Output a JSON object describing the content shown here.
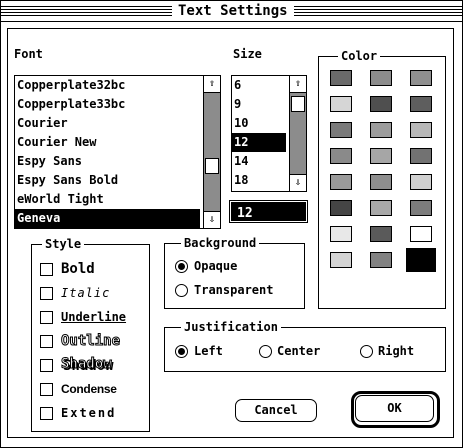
{
  "window": {
    "title": "Text Settings"
  },
  "font": {
    "label": "Font",
    "items": [
      {
        "label": "Copperplate32bc"
      },
      {
        "label": "Copperplate33bc"
      },
      {
        "label": "Courier"
      },
      {
        "label": "Courier New"
      },
      {
        "label": "Espy Sans"
      },
      {
        "label": "Espy Sans Bold"
      },
      {
        "label": "eWorld Tight"
      },
      {
        "label": "Geneva"
      }
    ],
    "selected": "Geneva"
  },
  "size": {
    "label": "Size",
    "items": [
      {
        "label": "6"
      },
      {
        "label": "9"
      },
      {
        "label": "10"
      },
      {
        "label": "12"
      },
      {
        "label": "14"
      },
      {
        "label": "18"
      }
    ],
    "selected": "12",
    "field_value": "12"
  },
  "color": {
    "label": "Color",
    "swatches": [
      "#6a6a6a",
      "#8c8c8c",
      "#8f8f8f",
      "#d6d6d6",
      "#4f4f4f",
      "#5e5e5e",
      "#7a7a7a",
      "#9c9c9c",
      "#b8b8b8",
      "#8a8a8a",
      "#a6a6a6",
      "#727272",
      "#9a9a9a",
      "#8e8e8e",
      "#d0d0d0",
      "#454545",
      "#a8a8a8",
      "#7c7c7c",
      "#e8e8e8",
      "#5a5a5a",
      "#ffffff",
      "#d4d4d4",
      "#828282",
      "#000000"
    ],
    "selected_index": 23
  },
  "style": {
    "label": "Style",
    "options": [
      {
        "label": "Bold",
        "checked": false
      },
      {
        "label": "Italic",
        "checked": false
      },
      {
        "label": "Underline",
        "checked": false
      },
      {
        "label": "Outline",
        "checked": false
      },
      {
        "label": "Shadow",
        "checked": false
      },
      {
        "label": "Condense",
        "checked": false
      },
      {
        "label": "Extend",
        "checked": false
      }
    ]
  },
  "background": {
    "label": "Background",
    "options": [
      {
        "label": "Opaque",
        "selected": true
      },
      {
        "label": "Transparent",
        "selected": false
      }
    ]
  },
  "justification": {
    "label": "Justification",
    "options": [
      {
        "label": "Left",
        "selected": true
      },
      {
        "label": "Center",
        "selected": false
      },
      {
        "label": "Right",
        "selected": false
      }
    ]
  },
  "buttons": {
    "cancel": "Cancel",
    "ok": "OK"
  }
}
